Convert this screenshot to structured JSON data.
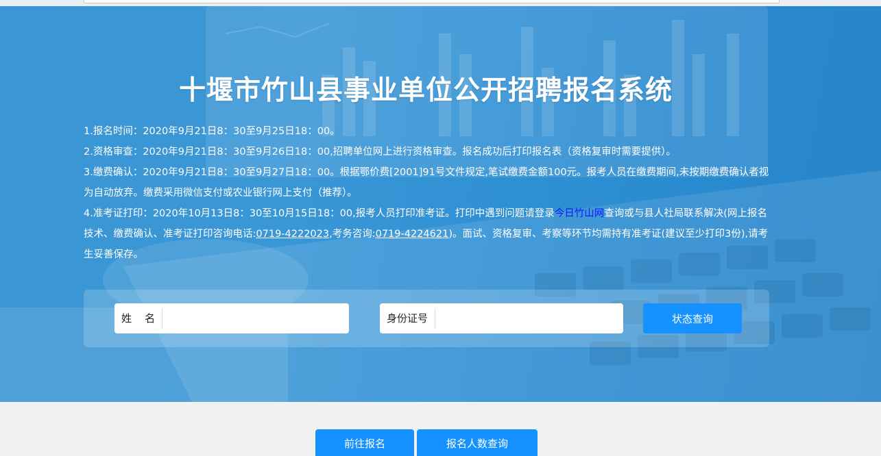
{
  "header": {
    "title": "十堰市竹山县事业单位公开招聘报名系统"
  },
  "notice": {
    "item1": "1.报名时间：2020年9月21日8：30至9月25日18：00。",
    "item2": "2.资格审查：2020年9月21日8：30至9月26日18：00,招聘单位网上进行资格审查。报名成功后打印报名表（资格复审时需要提供）。",
    "item3": "3.缴费确认：2020年9月21日8：30至9月27日18：00。根据鄂价费[2001]91号文件规定,笔试缴费金额100元。报考人员在缴费期间,未按期缴费确认者视为自动放弃。缴费采用微信支付或农业银行网上支付（推荐）。",
    "item4_prefix": "4.准考证打印：2020年10月13日8：30至10月15日18：00,报考人员打印准考证。打印中遇到问题请登录",
    "item4_link": "今日竹山网",
    "item4_middle": "查询或与县人社局联系解决(网上报名技术、缴费确认、准考证打印咨询电话:",
    "item4_tel1": "0719-4222023",
    "item4_tel_sep": ",考务咨询:",
    "item4_tel2": "0719-4224621",
    "item4_suffix": ")。面试、资格复审、考察等环节均需持有准考证(建议至少打印3份),请考生妥善保存。"
  },
  "search": {
    "name_label": "姓    名",
    "name_value": "",
    "id_label": "身份证号",
    "id_value": "",
    "query_button": "状态查询"
  },
  "actions": {
    "register_button": "前往报名",
    "count_button": "报名人数查询"
  },
  "colors": {
    "hero_blue": "#3a97d6",
    "button_blue": "#1592ff",
    "link_blue": "#0a1aff"
  }
}
